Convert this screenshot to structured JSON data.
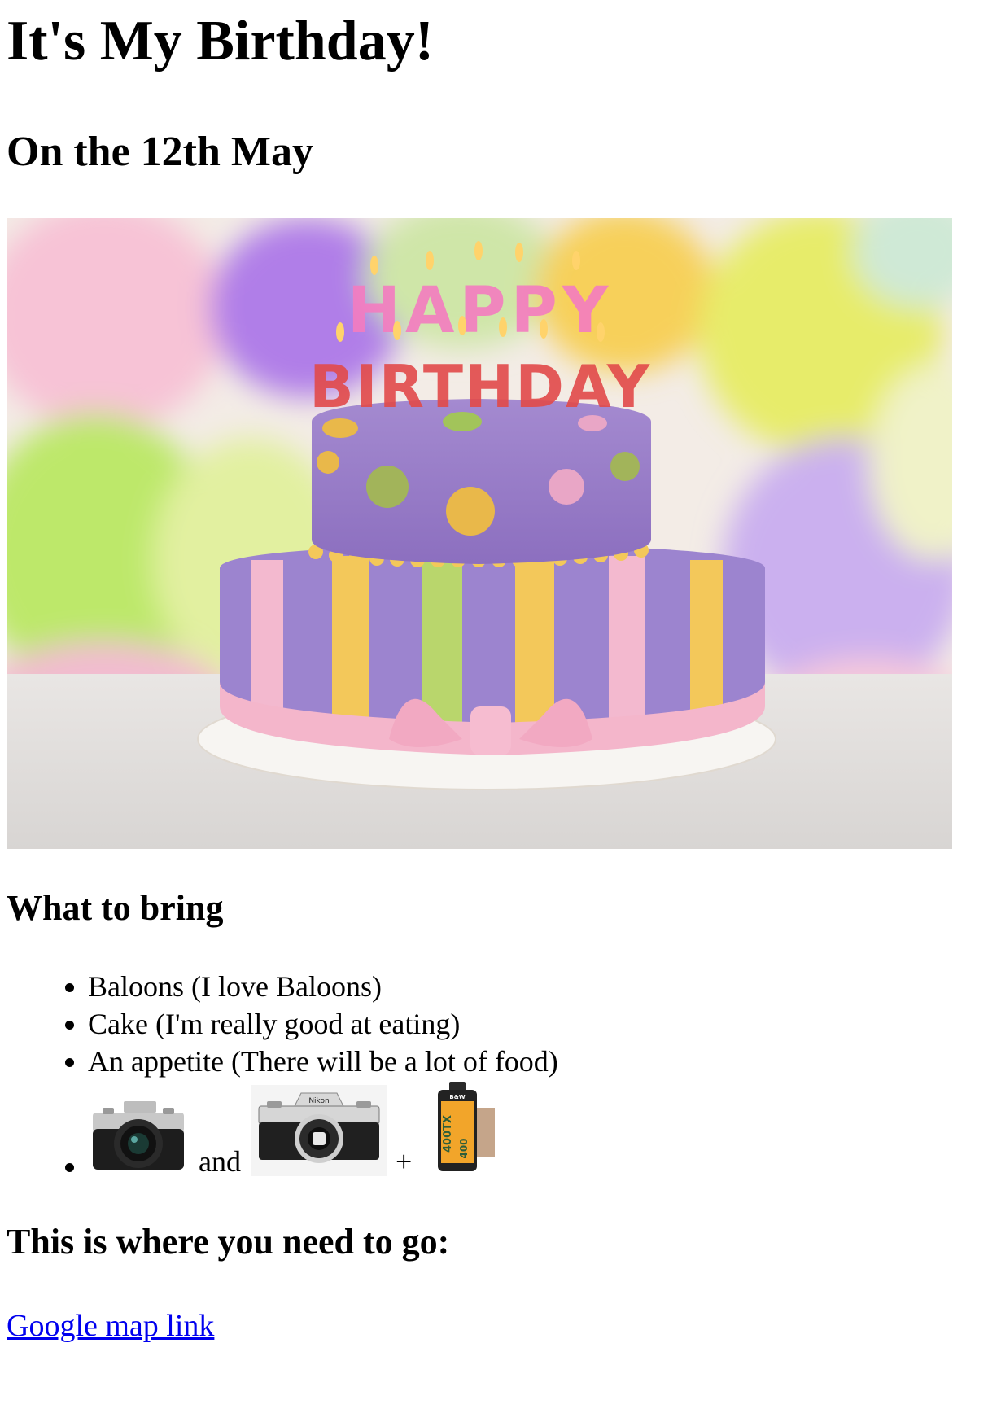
{
  "page": {
    "title": "It's My Birthday!",
    "date_heading": "On the 12th May",
    "hero": {
      "cake_candle_text": [
        "HAPPY",
        "BIRTHDAY"
      ]
    },
    "bring_heading": "What to bring",
    "bring_items": [
      "Baloons (I love Baloons)",
      "Cake (I'm really good at eating)",
      "An appetite (There will be a lot of food)"
    ],
    "gear": {
      "and_text": "and",
      "plus_text": "+",
      "camera2_brand": "Nikon",
      "film_brand": "B&W",
      "film_label": "400TX",
      "film_speed": "400"
    },
    "where_heading": "This is where you need to go:",
    "map_link": "Google map link"
  }
}
